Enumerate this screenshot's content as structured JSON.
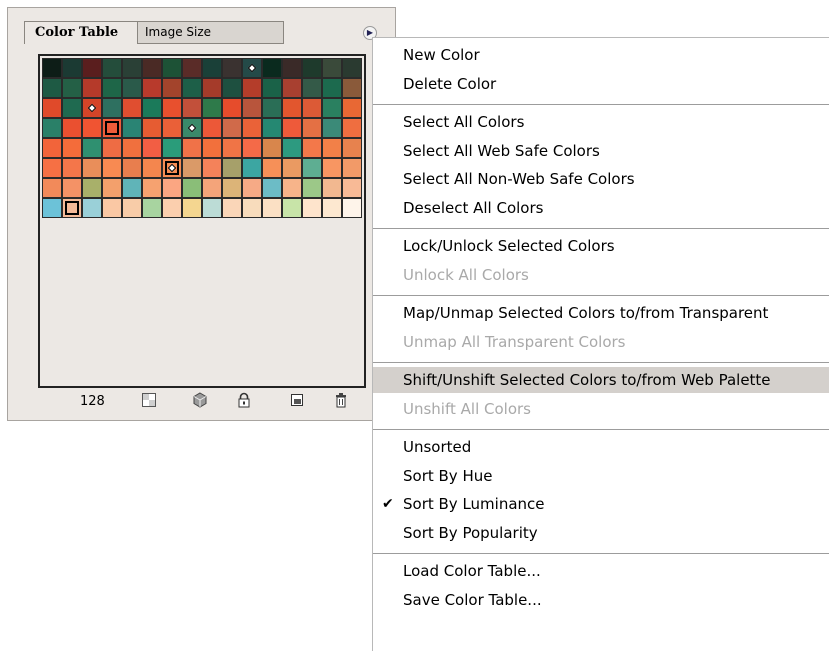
{
  "panel": {
    "tabs": [
      {
        "label": "Color Table"
      },
      {
        "label": "Image Size"
      }
    ],
    "color_count": "128",
    "colors": [
      [
        "#0d1d17",
        "#1b3a33",
        "#5a1e1e",
        "#244d3b",
        "#2a4036",
        "#4a2a25",
        "#1d5236",
        "#5a2c28",
        "#1a4038",
        "#3a3230",
        "#244a48",
        "#0a2a1e",
        "#3a2a28",
        "#1e3a2c",
        "#3a4a3a",
        "#2a3a30"
      ],
      [
        "#1e5a44",
        "#246046",
        "#b53a2a",
        "#1e6648",
        "#2a5a4a",
        "#b83a2c",
        "#a3442c",
        "#1d5f48",
        "#a53b2a",
        "#1e5040",
        "#b43d2a",
        "#1a6248",
        "#a84030",
        "#345a48",
        "#1c6a4e",
        "#8a5a3a"
      ],
      [
        "#e04a2a",
        "#1f6a50",
        "#d44428",
        "#2e7060",
        "#e04e30",
        "#1b7a5a",
        "#e8502e",
        "#c2503a",
        "#2e7a4a",
        "#e64c2c",
        "#b8553c",
        "#2a6e56",
        "#e2562e",
        "#dc5a36",
        "#2a8060",
        "#e86834"
      ],
      [
        "#2a8068",
        "#ea5030",
        "#f05432",
        "#ee5c3a",
        "#2a8474",
        "#e65c32",
        "#ea6038",
        "#3a8a6a",
        "#ec5838",
        "#d06a4a",
        "#ea6238",
        "#258872",
        "#ee5a3a",
        "#e47044",
        "#3b8a78",
        "#ef6e40"
      ],
      [
        "#f2643a",
        "#f46c3a",
        "#2f9070",
        "#ee6c44",
        "#f0703e",
        "#f25e44",
        "#2a9c7a",
        "#f07248",
        "#f2703c",
        "#f07446",
        "#f46a48",
        "#d8864c",
        "#2d9a80",
        "#f3784a",
        "#f28048",
        "#e7824e"
      ],
      [
        "#f67044",
        "#f4764a",
        "#e98e5a",
        "#f88a52",
        "#e87e4e",
        "#f4864e",
        "#f58c54",
        "#da9a68",
        "#f4825a",
        "#a6a06a",
        "#3ca6a2",
        "#f69058",
        "#ea9a62",
        "#5eae92",
        "#f89662",
        "#f29a68"
      ],
      [
        "#f28a5a",
        "#f49266",
        "#a8b06a",
        "#f3a06c",
        "#60b4b8",
        "#f6a270",
        "#fba682",
        "#8abe78",
        "#f4a47a",
        "#dcb478",
        "#f6aa86",
        "#6cbcc6",
        "#f7b48a",
        "#9cc888",
        "#f2b890",
        "#f8ba96"
      ],
      [
        "#6cc2d8",
        "#f4ba98",
        "#9ad0d8",
        "#fac8a4",
        "#f8cca8",
        "#a8d4a0",
        "#fbcfae",
        "#f4d690",
        "#bcdcd6",
        "#fad6b8",
        "#f8dcbc",
        "#fbe0c4",
        "#c8e4a8",
        "#fee4cc",
        "#fde8d0",
        "#fef4ea"
      ]
    ],
    "marks": [
      {
        "row": 0,
        "col": 10,
        "kind": "diamond"
      },
      {
        "row": 2,
        "col": 2,
        "kind": "diamond"
      },
      {
        "row": 3,
        "col": 3,
        "kind": "selected"
      },
      {
        "row": 3,
        "col": 7,
        "kind": "diamond"
      },
      {
        "row": 5,
        "col": 6,
        "kind": "selected-diamond"
      },
      {
        "row": 7,
        "col": 1,
        "kind": "selected"
      }
    ],
    "footer_icons": [
      "map-transparent-icon",
      "web-shift-icon",
      "lock-icon",
      "new-color-icon",
      "trash-icon"
    ]
  },
  "menu": {
    "groups": [
      [
        {
          "label": "New Color"
        },
        {
          "label": "Delete Color"
        }
      ],
      [
        {
          "label": "Select All Colors"
        },
        {
          "label": "Select All Web Safe Colors"
        },
        {
          "label": "Select All Non-Web Safe Colors"
        },
        {
          "label": "Deselect All Colors"
        }
      ],
      [
        {
          "label": "Lock/Unlock Selected Colors"
        },
        {
          "label": "Unlock All Colors",
          "disabled": true
        }
      ],
      [
        {
          "label": "Map/Unmap Selected Colors to/from Transparent"
        },
        {
          "label": "Unmap All Transparent Colors",
          "disabled": true
        }
      ],
      [
        {
          "label": "Shift/Unshift Selected Colors to/from Web Palette",
          "highlighted": true
        },
        {
          "label": "Unshift All Colors",
          "disabled": true
        }
      ],
      [
        {
          "label": "Unsorted"
        },
        {
          "label": "Sort By Hue"
        },
        {
          "label": "Sort By Luminance",
          "checked": true
        },
        {
          "label": "Sort By Popularity"
        }
      ],
      [
        {
          "label": "Load Color Table..."
        },
        {
          "label": "Save Color Table..."
        }
      ]
    ]
  },
  "colors": {
    "menu_highlight": "#d4d0cc",
    "disabled_text": "#a9a9a9",
    "panel_bg": "#ece8e4"
  }
}
